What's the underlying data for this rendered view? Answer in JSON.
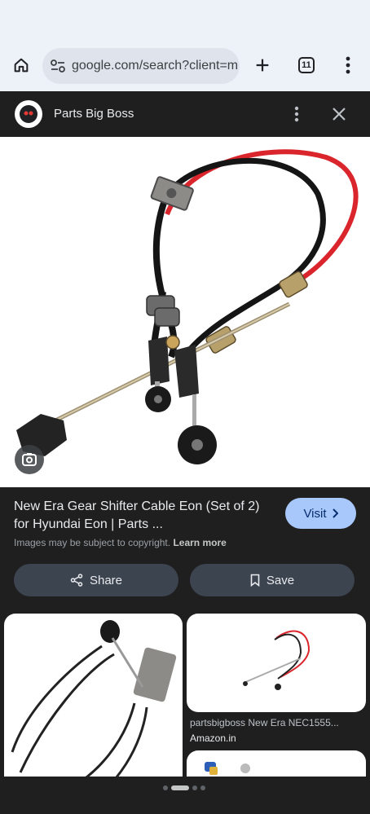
{
  "browser": {
    "url": "google.com/search?client=m",
    "tab_count": "11"
  },
  "viewer": {
    "site_name": "Parts Big Boss",
    "title": "New Era Gear Shifter Cable Eon (Set of 2) for Hyundai Eon | Parts ...",
    "visit_label": "Visit",
    "copyright_text": "Images may be subject to copyright.",
    "learn_more": "Learn more",
    "share_label": "Share",
    "save_label": "Save"
  },
  "related": [
    {
      "caption": "",
      "source": ""
    },
    {
      "caption": "partsbigboss New Era NEC1555...",
      "source": "Amazon.in"
    }
  ],
  "colors": {
    "accent_button": "#a8c7fa",
    "cable_red": "#d9252b",
    "background": "#1f1f1f"
  }
}
